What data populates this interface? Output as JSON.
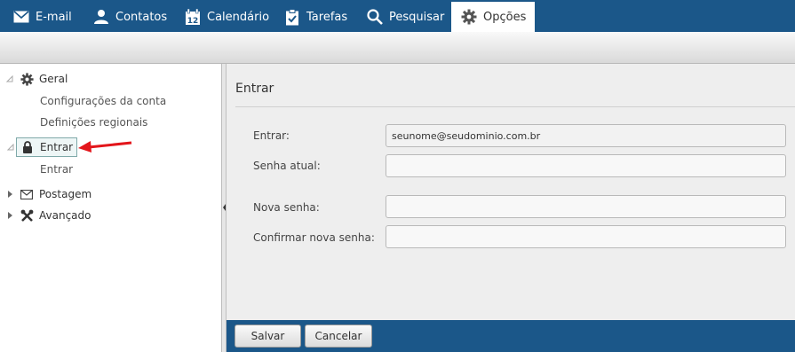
{
  "nav": {
    "tabs": [
      {
        "label": "E-mail",
        "icon": "mail-icon"
      },
      {
        "label": "Contatos",
        "icon": "person-icon"
      },
      {
        "label": "Calendário",
        "icon": "calendar-icon",
        "icon_text": "12"
      },
      {
        "label": "Tarefas",
        "icon": "clipboard-icon"
      },
      {
        "label": "Pesquisar",
        "icon": "search-icon"
      },
      {
        "label": "Opções",
        "icon": "gear-icon",
        "active": true
      }
    ]
  },
  "sidebar": {
    "geral": {
      "label": "Geral",
      "children": [
        "Configurações da conta",
        "Definições regionais"
      ]
    },
    "entrar": {
      "label": "Entrar",
      "children": [
        "Entrar"
      ]
    },
    "postagem": {
      "label": "Postagem"
    },
    "avancado": {
      "label": "Avançado"
    }
  },
  "main": {
    "title": "Entrar",
    "fields": [
      {
        "label": "Entrar:",
        "value": "seunome@seudominio.com.br"
      },
      {
        "label": "Senha atual:",
        "value": ""
      },
      {
        "label": "Nova senha:",
        "value": ""
      },
      {
        "label": "Confirmar nova senha:",
        "value": ""
      }
    ]
  },
  "footer": {
    "save_label": "Salvar",
    "cancel_label": "Cancelar"
  },
  "colors": {
    "nav_bg": "#1b5789",
    "annotation_arrow": "#e3161b"
  }
}
